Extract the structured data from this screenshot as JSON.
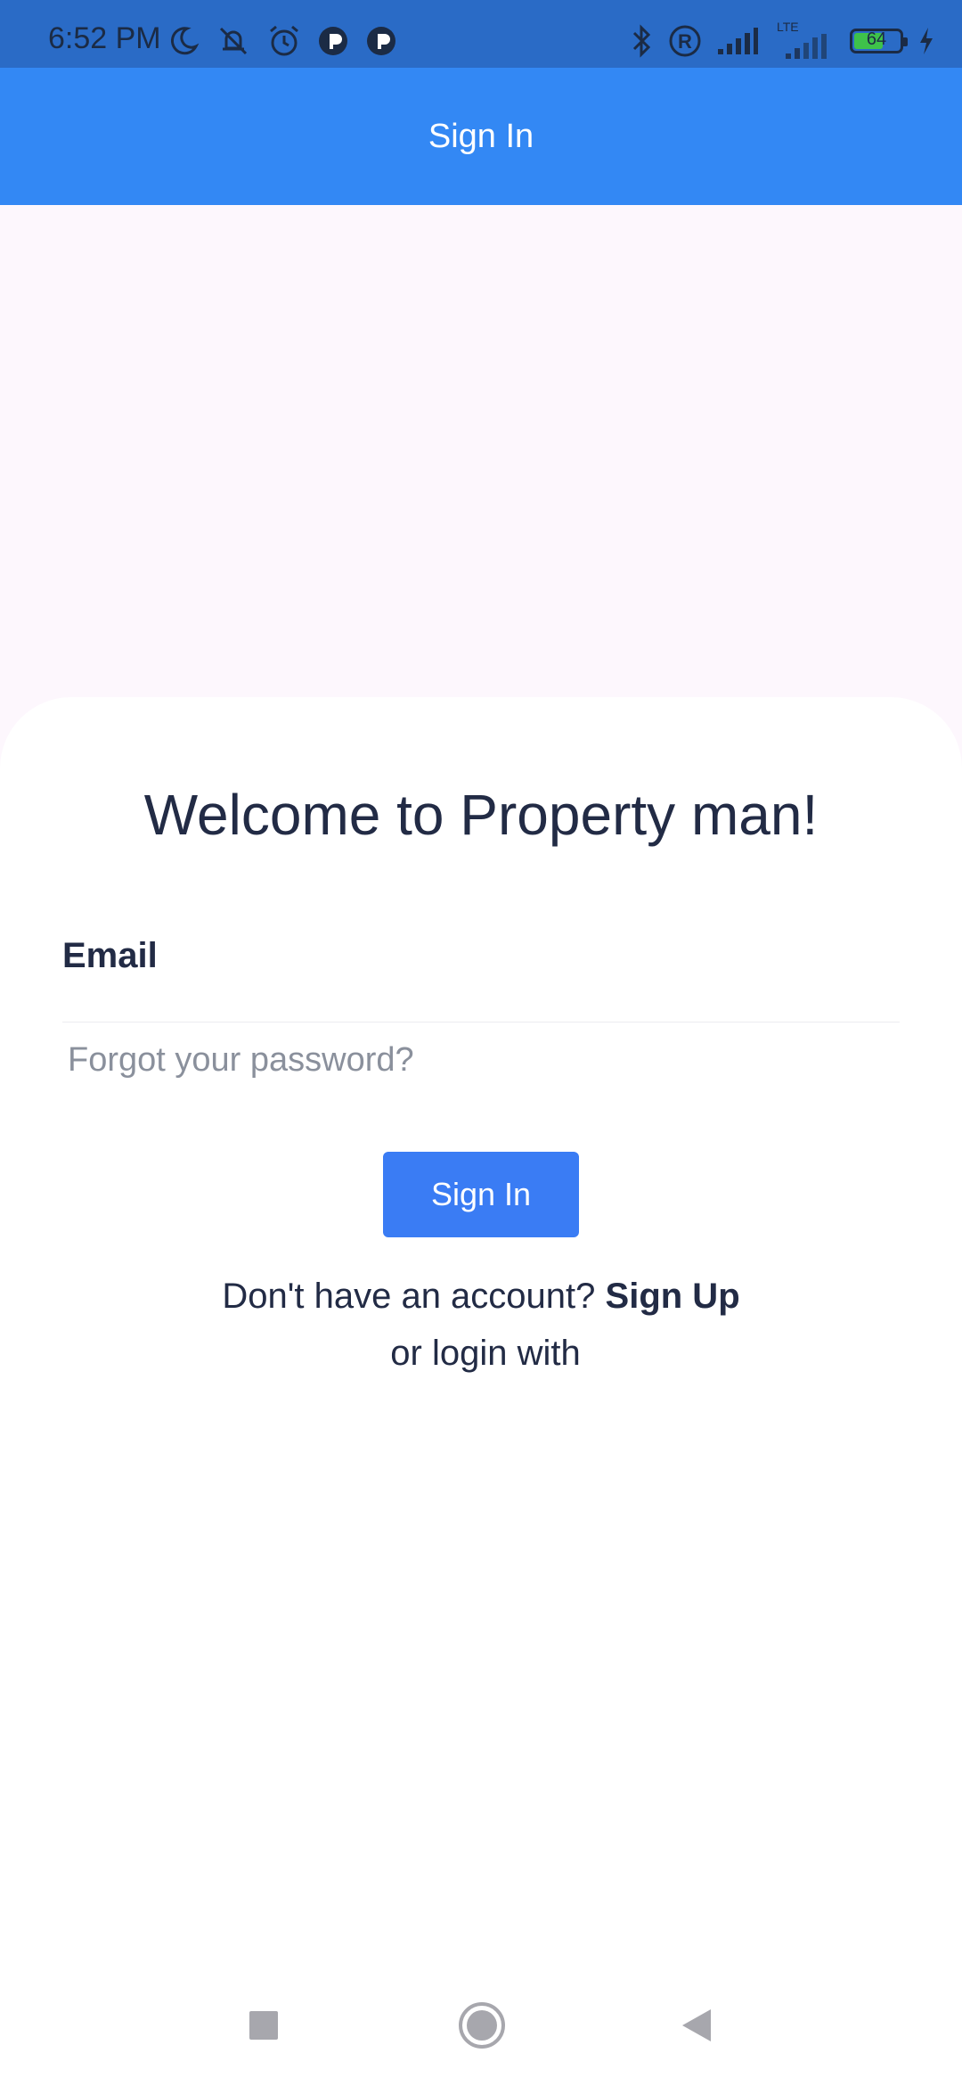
{
  "status_bar": {
    "time": "6:52 PM",
    "battery_level": "64",
    "battery_fraction": 0.64,
    "icons_left": [
      "moon-icon",
      "bell-muted-icon",
      "alarm-icon",
      "app-notification-icon",
      "app-notification-icon"
    ],
    "icons_right": [
      "bluetooth-icon",
      "registered-icon",
      "signal-icon",
      "lte-signal-icon",
      "battery-icon",
      "charging-icon"
    ],
    "lte_label": "LTE"
  },
  "app_bar": {
    "title": "Sign In"
  },
  "form": {
    "welcome": "Welcome to Property man!",
    "email_label": "Email",
    "email_value": "",
    "forgot_password": "Forgot your password?",
    "sign_in_button": "Sign In",
    "no_account_text": "Don't have an account?",
    "sign_up_link": "Sign Up",
    "or_login_with": "or login with"
  },
  "colors": {
    "status_bar": "#2a6bc6",
    "app_bar": "#3388f4",
    "button": "#3a7cf4",
    "text": "#222b45",
    "background": "#fdf7fd"
  },
  "nav_bar": {
    "buttons": [
      "recents-button",
      "home-button",
      "back-button"
    ]
  }
}
